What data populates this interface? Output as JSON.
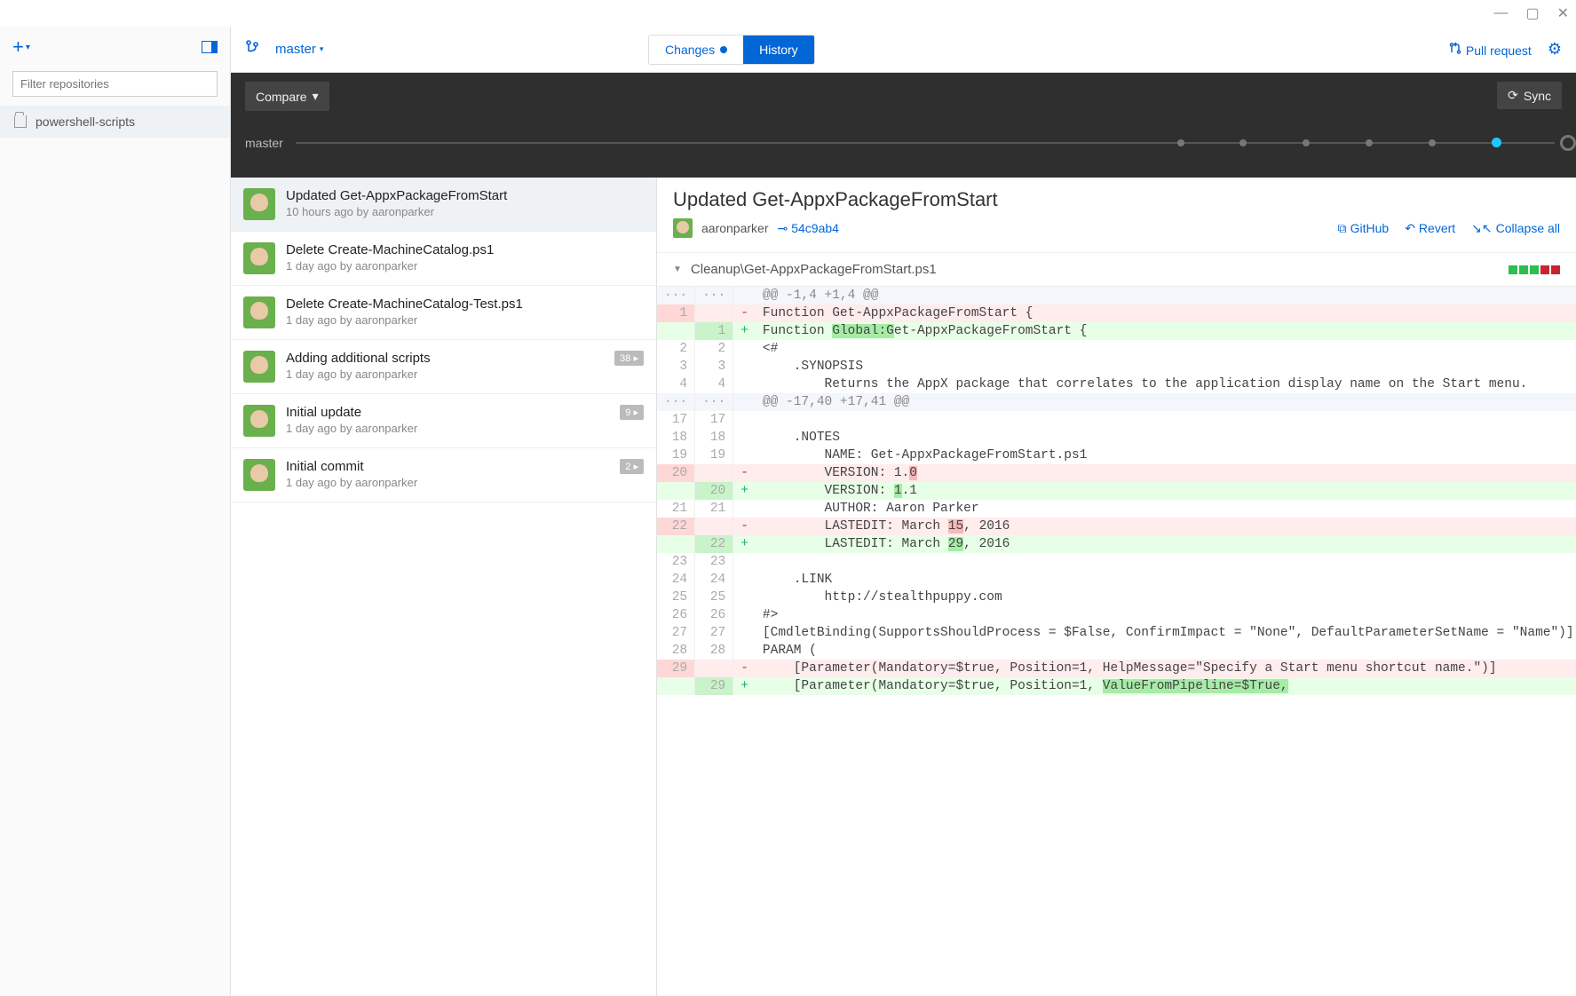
{
  "window_controls": {
    "min": "—",
    "max": "▢",
    "close": "✕"
  },
  "sidebar": {
    "filter_placeholder": "Filter repositories",
    "repos": [
      {
        "name": "powershell-scripts"
      }
    ]
  },
  "header": {
    "branch": "master",
    "tabs": {
      "changes": "Changes",
      "history": "History"
    },
    "pull_request": "Pull request"
  },
  "darkbar": {
    "compare": "Compare",
    "sync": "Sync",
    "branch_label": "master"
  },
  "commits": [
    {
      "title": "Updated Get-AppxPackageFromStart",
      "meta": "10 hours ago by aaronparker",
      "badge": "",
      "selected": true
    },
    {
      "title": "Delete Create-MachineCatalog.ps1",
      "meta": "1 day ago by aaronparker",
      "badge": ""
    },
    {
      "title": "Delete Create-MachineCatalog-Test.ps1",
      "meta": "1 day ago by aaronparker",
      "badge": ""
    },
    {
      "title": "Adding additional scripts",
      "meta": "1 day ago by aaronparker",
      "badge": "38 ▸"
    },
    {
      "title": "Initial update",
      "meta": "1 day ago by aaronparker",
      "badge": "9 ▸"
    },
    {
      "title": "Initial commit",
      "meta": "1 day ago by aaronparker",
      "badge": "2 ▸"
    }
  ],
  "diff": {
    "title": "Updated Get-AppxPackageFromStart",
    "author": "aaronparker",
    "sha": "54c9ab4",
    "actions": {
      "github": "GitHub",
      "revert": "Revert",
      "collapse": "Collapse all"
    },
    "file": "Cleanup\\Get-AppxPackageFromStart.ps1",
    "lines": [
      {
        "t": "hunk",
        "a": "···",
        "b": "···",
        "s": "",
        "c": "@@ -1,4 +1,4 @@"
      },
      {
        "t": "del",
        "a": "1",
        "b": "",
        "s": "-",
        "c": "Function Get-AppxPackageFromStart {"
      },
      {
        "t": "add",
        "a": "",
        "b": "1",
        "s": "+",
        "c": "Function Global:Get-AppxPackageFromStart {",
        "hl": "Global:G"
      },
      {
        "t": "ctx",
        "a": "2",
        "b": "2",
        "s": "",
        "c": "<#"
      },
      {
        "t": "ctx",
        "a": "3",
        "b": "3",
        "s": "",
        "c": "    .SYNOPSIS"
      },
      {
        "t": "ctx",
        "a": "4",
        "b": "4",
        "s": "",
        "c": "        Returns the AppX package that correlates to the application display name on the Start menu."
      },
      {
        "t": "hunk",
        "a": "···",
        "b": "···",
        "s": "",
        "c": "@@ -17,40 +17,41 @@"
      },
      {
        "t": "ctx",
        "a": "17",
        "b": "17",
        "s": "",
        "c": ""
      },
      {
        "t": "ctx",
        "a": "18",
        "b": "18",
        "s": "",
        "c": "    .NOTES"
      },
      {
        "t": "ctx",
        "a": "19",
        "b": "19",
        "s": "",
        "c": "        NAME: Get-AppxPackageFromStart.ps1"
      },
      {
        "t": "del",
        "a": "20",
        "b": "",
        "s": "-",
        "c": "        VERSION: 1.0",
        "hl": "0"
      },
      {
        "t": "add",
        "a": "",
        "b": "20",
        "s": "+",
        "c": "        VERSION: 1.1",
        "hl": "1"
      },
      {
        "t": "ctx",
        "a": "21",
        "b": "21",
        "s": "",
        "c": "        AUTHOR: Aaron Parker"
      },
      {
        "t": "del",
        "a": "22",
        "b": "",
        "s": "-",
        "c": "        LASTEDIT: March 15, 2016",
        "hl": "15"
      },
      {
        "t": "add",
        "a": "",
        "b": "22",
        "s": "+",
        "c": "        LASTEDIT: March 29, 2016",
        "hl": "29"
      },
      {
        "t": "ctx",
        "a": "23",
        "b": "23",
        "s": "",
        "c": ""
      },
      {
        "t": "ctx",
        "a": "24",
        "b": "24",
        "s": "",
        "c": "    .LINK"
      },
      {
        "t": "ctx",
        "a": "25",
        "b": "25",
        "s": "",
        "c": "        http://stealthpuppy.com"
      },
      {
        "t": "ctx",
        "a": "26",
        "b": "26",
        "s": "",
        "c": "#>"
      },
      {
        "t": "ctx",
        "a": "27",
        "b": "27",
        "s": "",
        "c": "[CmdletBinding(SupportsShouldProcess = $False, ConfirmImpact = \"None\", DefaultParameterSetName = \"Name\")]"
      },
      {
        "t": "ctx",
        "a": "28",
        "b": "28",
        "s": "",
        "c": "PARAM ("
      },
      {
        "t": "del",
        "a": "29",
        "b": "",
        "s": "-",
        "c": "    [Parameter(Mandatory=$true, Position=1, HelpMessage=\"Specify a Start menu shortcut name.\")]"
      },
      {
        "t": "add",
        "a": "",
        "b": "29",
        "s": "+",
        "c": "    [Parameter(Mandatory=$true, Position=1, ValueFromPipeline=$True,",
        "hl": "ValueFromPipeline=$True,"
      }
    ]
  }
}
